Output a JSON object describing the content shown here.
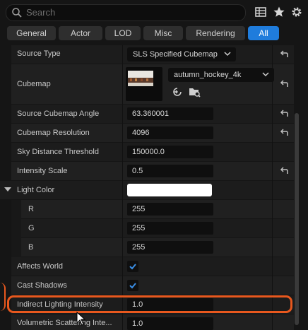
{
  "search": {
    "placeholder": "Search"
  },
  "tabs": [
    "General",
    "Actor",
    "LOD",
    "Misc",
    "Rendering",
    "All"
  ],
  "active_tab": "All",
  "properties": {
    "source_type": {
      "label": "Source Type",
      "value": "SLS Specified Cubemap"
    },
    "cubemap": {
      "label": "Cubemap",
      "asset": "autumn_hockey_4k"
    },
    "source_cubemap_angle": {
      "label": "Source Cubemap Angle",
      "value": "63.360001"
    },
    "cubemap_resolution": {
      "label": "Cubemap Resolution",
      "value": "4096"
    },
    "sky_distance_threshold": {
      "label": "Sky Distance Threshold",
      "value": "150000.0"
    },
    "intensity_scale": {
      "label": "Intensity Scale",
      "value": "0.5"
    },
    "light_color": {
      "label": "Light Color",
      "swatch": "#ffffff",
      "r_label": "R",
      "r": "255",
      "g_label": "G",
      "g": "255",
      "b_label": "B",
      "b": "255"
    },
    "affects_world": {
      "label": "Affects World",
      "checked": true
    },
    "cast_shadows": {
      "label": "Cast Shadows",
      "checked": true
    },
    "indirect_lighting_intensity": {
      "label": "Indirect Lighting Intensity",
      "value": "1.0"
    },
    "volumetric_scattering_intensity": {
      "label": "Volumetric Scattering Inte...",
      "value": "1.0"
    }
  },
  "colors": {
    "accent": "#1f7cdc",
    "highlight": "#e8581e",
    "check": "#3a8ee6"
  }
}
